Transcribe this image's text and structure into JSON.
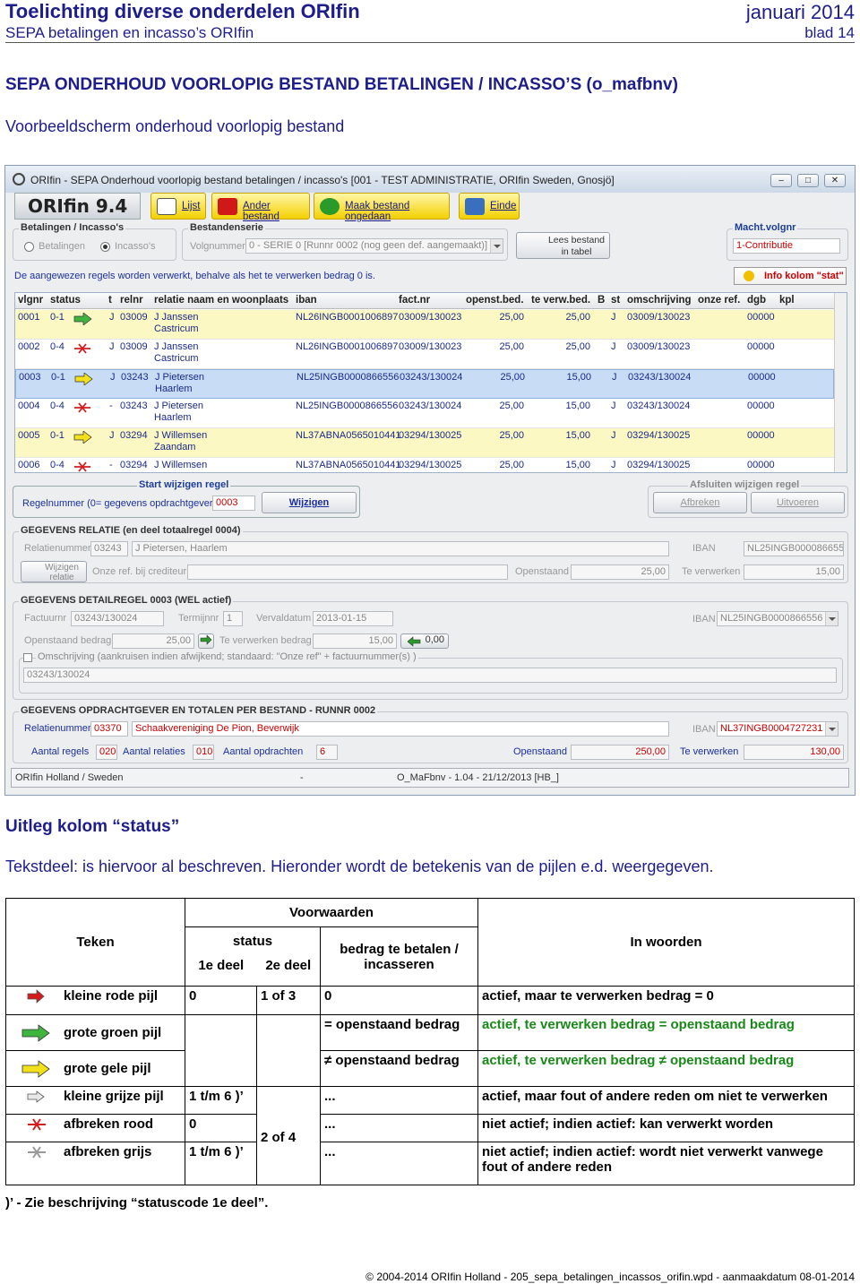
{
  "header": {
    "title": "Toelichting diverse onderdelen ORIfin",
    "date": "januari 2014",
    "subtitle": "SEPA betalingen en incasso’s ORIfin",
    "page": "blad 14"
  },
  "section_title": "SEPA ONDERHOUD VOORLOPIG BESTAND BETALINGEN / INCASSO’S (o_mafbnv)",
  "section_subtitle": "Voorbeeldscherm onderhoud voorlopig bestand",
  "app": {
    "window_title": "ORIfin - SEPA Onderhoud voorlopig bestand betalingen / incasso's [001 - TEST ADMINISTRATIE, ORIfin Sweden, Gnosjö]",
    "logo": "ORIfin 9.4",
    "toolbar": {
      "lijst": "Lijst",
      "ander": "Ander bestand",
      "maak": "Maak bestand ongedaan",
      "einde": "Einde"
    },
    "group_bet": "Betalingen / Incasso's",
    "radio_bet": "Betalingen",
    "radio_inc": "Incasso's",
    "group_serie": "Bestandenserie",
    "volgnummer_label": "Volgnummer",
    "volgnummer_value": "0 - SERIE 0  [Runnr 0002 (nog geen def. aangemaakt)]",
    "lees_bestand": "Lees bestand",
    "in_tabel": "in tabel",
    "macht_label": "Macht.volgnr",
    "macht_value": "1-Contributie",
    "notice": "De aangewezen regels worden verwerkt, behalve als het te verwerken bedrag 0 is.",
    "info_button": "Info kolom \"stat\"",
    "grid_headers": [
      "vlgnr",
      "status",
      "t",
      "relnr",
      "relatie naam en woonplaats",
      "iban",
      "fact.nr",
      "openst.bed.",
      "te verw.bed.",
      "B",
      "st",
      "omschrijving",
      "onze ref.",
      "dgb",
      "kpl"
    ],
    "rows": [
      {
        "vlgnr": "0001",
        "status": "0-1",
        "t": "J",
        "relnr": "03009",
        "naam": "J Janssen",
        "plaats": "Castricum",
        "iban": "NL26INGB0001006897",
        "fact": "03009/130023",
        "open": "25,00",
        "verw": "25,00",
        "st": "J",
        "oms": "03009/130023",
        "dgb": "00000",
        "arrow": "green"
      },
      {
        "vlgnr": "0002",
        "status": "0-4",
        "t": "J",
        "relnr": "03009",
        "naam": "J Janssen",
        "plaats": "Castricum",
        "iban": "NL26INGB0001006897",
        "fact": "03009/130023",
        "open": "25,00",
        "verw": "25,00",
        "st": "J",
        "oms": "03009/130023",
        "dgb": "00000",
        "arrow": "xred"
      },
      {
        "vlgnr": "0003",
        "status": "0-1",
        "t": "J",
        "relnr": "03243",
        "naam": "J Pietersen",
        "plaats": "Haarlem",
        "iban": "NL25INGB0000866556",
        "fact": "03243/130024",
        "open": "25,00",
        "verw": "15,00",
        "st": "J",
        "oms": "03243/130024",
        "dgb": "00000",
        "arrow": "yellow"
      },
      {
        "vlgnr": "0004",
        "status": "0-4",
        "t": "-",
        "relnr": "03243",
        "naam": "J Pietersen",
        "plaats": "Haarlem",
        "iban": "NL25INGB0000866556",
        "fact": "03243/130024",
        "open": "25,00",
        "verw": "15,00",
        "st": "J",
        "oms": "03243/130024",
        "dgb": "00000",
        "arrow": "xred"
      },
      {
        "vlgnr": "0005",
        "status": "0-1",
        "t": "J",
        "relnr": "03294",
        "naam": "J Willemsen",
        "plaats": "Zaandam",
        "iban": "NL37ABNA0565010441",
        "fact": "03294/130025",
        "open": "25,00",
        "verw": "15,00",
        "st": "J",
        "oms": "03294/130025",
        "dgb": "00000",
        "arrow": "yellow"
      },
      {
        "vlgnr": "0006",
        "status": "0-4",
        "t": "-",
        "relnr": "03294",
        "naam": "J Willemsen",
        "plaats": "",
        "iban": "NL37ABNA0565010441",
        "fact": "03294/130025",
        "open": "25,00",
        "verw": "15,00",
        "st": "J",
        "oms": "03294/130025",
        "dgb": "00000",
        "arrow": "xred"
      }
    ],
    "start_wijzigen": "Start wijzigen regel",
    "regelnummer_label": "Regelnummer (0= gegevens opdrachtgever)",
    "regelnummer_value": "0003",
    "wijzigen": "Wijzigen",
    "afsluiten": "Afsluiten wijzigen regel",
    "afbreken": "Afbreken",
    "uitvoeren": "Uitvoeren",
    "relatie_group": "GEGEVENS RELATIE (en deel totaalregel 0004)",
    "relatienummer_label": "Relatienummer",
    "relatienummer_value": "03243",
    "relatie_naam": "J Pietersen, Haarlem",
    "iban_label": "IBAN",
    "relatie_iban": "NL25INGB0000866556",
    "wijzigen_relatie_1": "Wijzigen",
    "wijzigen_relatie_2": "relatie",
    "onze_ref_label": "Onze ref. bij crediteur",
    "openstaand_label": "Openstaand",
    "relatie_openstaand": "25,00",
    "te_verwerken_label": "Te verwerken",
    "relatie_te_verwerken": "15,00",
    "detail_group": "GEGEVENS DETAILREGEL 0003 (WEL actief)",
    "factuurnr_label": "Factuurnr",
    "factuurnr_value": "03243/130024",
    "termijnnr_label": "Termijnnr",
    "termijnnr_value": "1",
    "vervaldatum_label": "Vervaldatum",
    "vervaldatum_value": "2013-01-15",
    "detail_iban": "NL25INGB0000866556",
    "openstaand_bedrag_label": "Openstaand bedrag",
    "openstaand_bedrag_value": "25,00",
    "te_verwerken_bedrag_label": "Te verwerken bedrag",
    "te_verwerken_bedrag_value": "15,00",
    "zero_value": "0,00",
    "omschrijving_label": "Omschrijving (aankruisen indien afwijkend; standaard: \"Onze ref\" + factuurnummer(s) )",
    "omschrijving_value": "03243/130024",
    "opdracht_group": "GEGEVENS OPDRACHTGEVER EN TOTALEN PER BESTAND - RUNNR 0002",
    "opdracht_relnr": "03370",
    "opdracht_naam": "Schaakvereniging De Pion, Beverwijk",
    "opdracht_iban": "NL37INGB0004727231",
    "aantal_regels_label": "Aantal regels",
    "aantal_regels": "020",
    "aantal_relaties_label": "Aantal relaties",
    "aantal_relaties": "010",
    "aantal_opdrachten_label": "Aantal opdrachten",
    "aantal_opdrachten": "6",
    "opdracht_openstaand": "250,00",
    "opdracht_te_verwerken": "130,00",
    "status_left": "ORIfin Holland / Sweden",
    "status_mid": "-",
    "status_right": "O_MaFbnv - 1.04 - 21/12/2013 [HB_]"
  },
  "uitleg_title": "Uitleg kolom “status”",
  "uitleg_text": "Tekstdeel: is hiervoor al beschreven. Hieronder wordt de betekenis van de pijlen e.d. weergegeven.",
  "table": {
    "h_voorwaarden": "Voorwaarden",
    "h_teken": "Teken",
    "h_status": "status",
    "h_bedrag": "bedrag te betalen / incasseren",
    "h_woorden": "In woorden",
    "h_deel1": "1e deel",
    "h_deel2": "2e deel",
    "rows": [
      {
        "teken": "kleine rode pijl",
        "s1": "0",
        "s2": "1 of 3",
        "bedrag": "0",
        "woorden": "actief, maar te verwerken bedrag = 0"
      },
      {
        "teken": "grote groen pijl",
        "bedrag": "= openstaand bedrag",
        "woorden": "actief, te verwerken bedrag = openstaand bedrag"
      },
      {
        "teken": "grote gele pijl",
        "bedrag": "≠ openstaand bedrag",
        "woorden": "actief, te verwerken bedrag ≠ openstaand bedrag"
      },
      {
        "teken": "kleine grijze pijl",
        "s1": "1 t/m 6 )’",
        "bedrag": "...",
        "woorden": "actief, maar fout of andere reden om niet te verwerken"
      },
      {
        "teken": "afbreken rood",
        "s1": "0",
        "s2": "2 of 4",
        "bedrag": "...",
        "woorden": "niet actief; indien actief: kan verwerkt worden"
      },
      {
        "teken": "afbreken grijs",
        "s1": "1 t/m 6 )’",
        "bedrag": "...",
        "woorden": "niet actief; indien actief: wordt niet verwerkt vanwege fout of andere reden"
      }
    ]
  },
  "footnote": ")’ - Zie beschrijving “statuscode 1e deel”.",
  "footer": "© 2004-2014 ORIfin Holland - 205_sepa_betalingen_incassos_orifin.wpd - aanmaakdatum 08-01-2014"
}
